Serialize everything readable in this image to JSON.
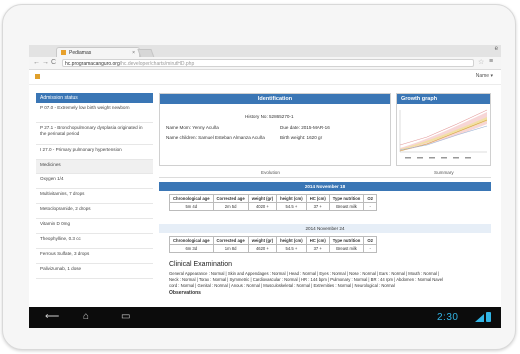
{
  "browser": {
    "tab_title": "Pediamas",
    "tab_close": "×",
    "url_domain": "hc.programacanguro.org",
    "url_path": "/hc.developer/charts/mirutHD.php"
  },
  "app": {
    "user_menu": "Name ▾"
  },
  "sidebar": {
    "header": "Admission status",
    "items": [
      "P 07.0 - Extremely low birth weight newborn",
      "P 27.1 - Bronchopulmonary dysplasia originated in the perinatal period",
      "I 27.0 - Primary pulmonary hypertension",
      "Medicines",
      "Oxygen 1/4",
      "Multivitamins, 7 drops",
      "Metoclopramide, 2 drops",
      "Vitamin D 0mg",
      "Theophylline, 0.3 cc",
      "Ferrous Sulfate, 3 drops",
      "Palivizumab, 1 dose"
    ]
  },
  "identification": {
    "header": "Identification",
    "history": "History No: 52865270-1",
    "mom": "Name Mom: Yenny Acuña",
    "due_date": "Due date: 2015-MAR-16",
    "children": "Name children: Samuel Esteban Almanza Acuña",
    "birth_weight": "Birth weight: 1620 gr"
  },
  "graph": {
    "header": "Growth graph"
  },
  "tabs": {
    "evolution": "Evolution",
    "summary": "Summary"
  },
  "visits": [
    {
      "date": "2014 November 18",
      "cols": [
        "Chronological age",
        "Corrected age",
        "weight (gr)",
        "height (cm)",
        "HC (cm)",
        "Type nutrition",
        "O2"
      ],
      "vals": [
        "5m 4d",
        "2m 5d",
        "4020 +",
        "54.5 +",
        "37 +",
        "Breast milk",
        "-"
      ]
    },
    {
      "date": "2014 November 24",
      "cols": [
        "Chronological age",
        "Corrected age",
        "weight (gr)",
        "height (cm)",
        "HC (cm)",
        "Type nutrition",
        "O2"
      ],
      "vals": [
        "6m 3d",
        "1m 8d",
        "4620 +",
        "54.5 +",
        "37 +",
        "Breast milk",
        "-"
      ]
    }
  ],
  "exam": {
    "title": "Clinical Examination",
    "line1": "General Appearance : Normal | Skin and Appendages : Normal | Head : Normal | Eyes : Normal | Nose : Normal | Ears : Normal | Mouth : Normal |",
    "line2": "Neck : Normal | Torax : Normal | Symmetric | Cardiovascular : Normal | HR : 144 bpm | Pulmonary : Normal | BR : 44 rpm | Abdomen : Normal Navel",
    "line3": "cord : Normal | Genital : Normal | Anous : Normal | Musculoskeletal : Normal | Extremities : Normal | Neurological : Normal",
    "obs": "Observations"
  },
  "status": {
    "clock": "2:30"
  }
}
